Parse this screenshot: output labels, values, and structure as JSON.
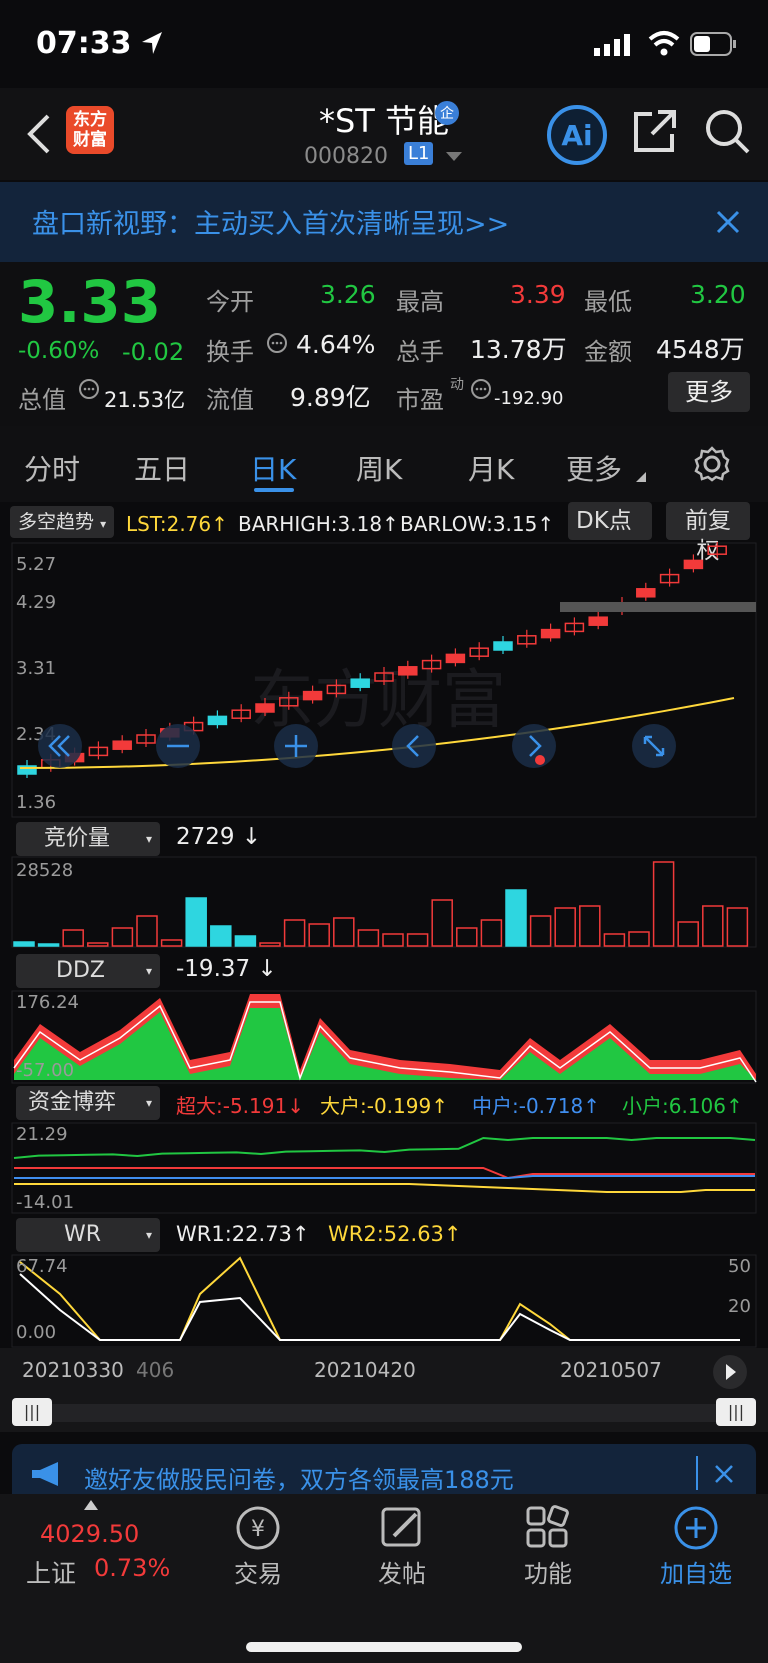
{
  "status": {
    "time": "07:33"
  },
  "header": {
    "title": "*ST 节能",
    "code": "000820",
    "level": "L1",
    "logo": "东方\n财富"
  },
  "banner": {
    "text": "盘口新视野：主动买入首次清晰呈现>>"
  },
  "quote": {
    "price": "3.33",
    "pct": "-0.60%",
    "chg": "-0.02",
    "open_label": "今开",
    "open": "3.26",
    "high_label": "最高",
    "high": "3.39",
    "low_label": "最低",
    "low": "3.20",
    "turnover_label": "换手",
    "turnover": "4.64%",
    "vol_label": "总手",
    "vol": "13.78万",
    "amt_label": "金额",
    "amt": "4548万",
    "mcap_label": "总值",
    "mcap": "21.53亿",
    "float_label": "流值",
    "float": "9.89亿",
    "pe_label": "市盈",
    "pe_sup": "动",
    "pe": "-192.90",
    "more": "更多"
  },
  "tabs": [
    "分时",
    "五日",
    "日K",
    "周K",
    "月K",
    "更多"
  ],
  "kline": {
    "indicator": "多空趋势",
    "lst": "LST:2.76",
    "barhigh": "BARHIGH:3.18",
    "barlow": "BARLOW:3.15",
    "dk": "DK点",
    "fq": "前复权",
    "yticks": [
      "5.27",
      "4.29",
      "3.31",
      "2.34",
      "1.36"
    ]
  },
  "vol": {
    "indicator": "竞价量",
    "value": "2729",
    "ymax": "28528"
  },
  "ddz": {
    "indicator": "DDZ",
    "value": "-19.37",
    "ymax": "176.24",
    "ymin": "-57.00"
  },
  "fund": {
    "indicator": "资金博弈",
    "chaoda": "超大:-5.191",
    "dahu": "大户:-0.199",
    "zhonghu": "中户:-0.718",
    "xiaohu": "小户:6.106",
    "ymax": "21.29",
    "ymin": "-14.01"
  },
  "wr": {
    "indicator": "WR",
    "wr1": "WR1:22.73",
    "wr2": "WR2:52.63",
    "ymax": "67.74",
    "ymin": "0.00",
    "r50": "50",
    "r20": "20"
  },
  "dates": [
    "20210330",
    "406",
    "20210420",
    "20210507"
  ],
  "promo": {
    "text": "邀好友做股民问卷，双方各领最高188元"
  },
  "bottom": {
    "index_value": "4029.50",
    "index_name": "上证",
    "index_pct": "0.73%",
    "trade": "交易",
    "post": "发帖",
    "func": "功能",
    "add": "加自选"
  },
  "colors": {
    "up": "#f23a3a",
    "down": "#21c742",
    "accent": "#3a91e8",
    "cyan": "#2ed6e0",
    "yellow": "#ffd83b"
  }
}
